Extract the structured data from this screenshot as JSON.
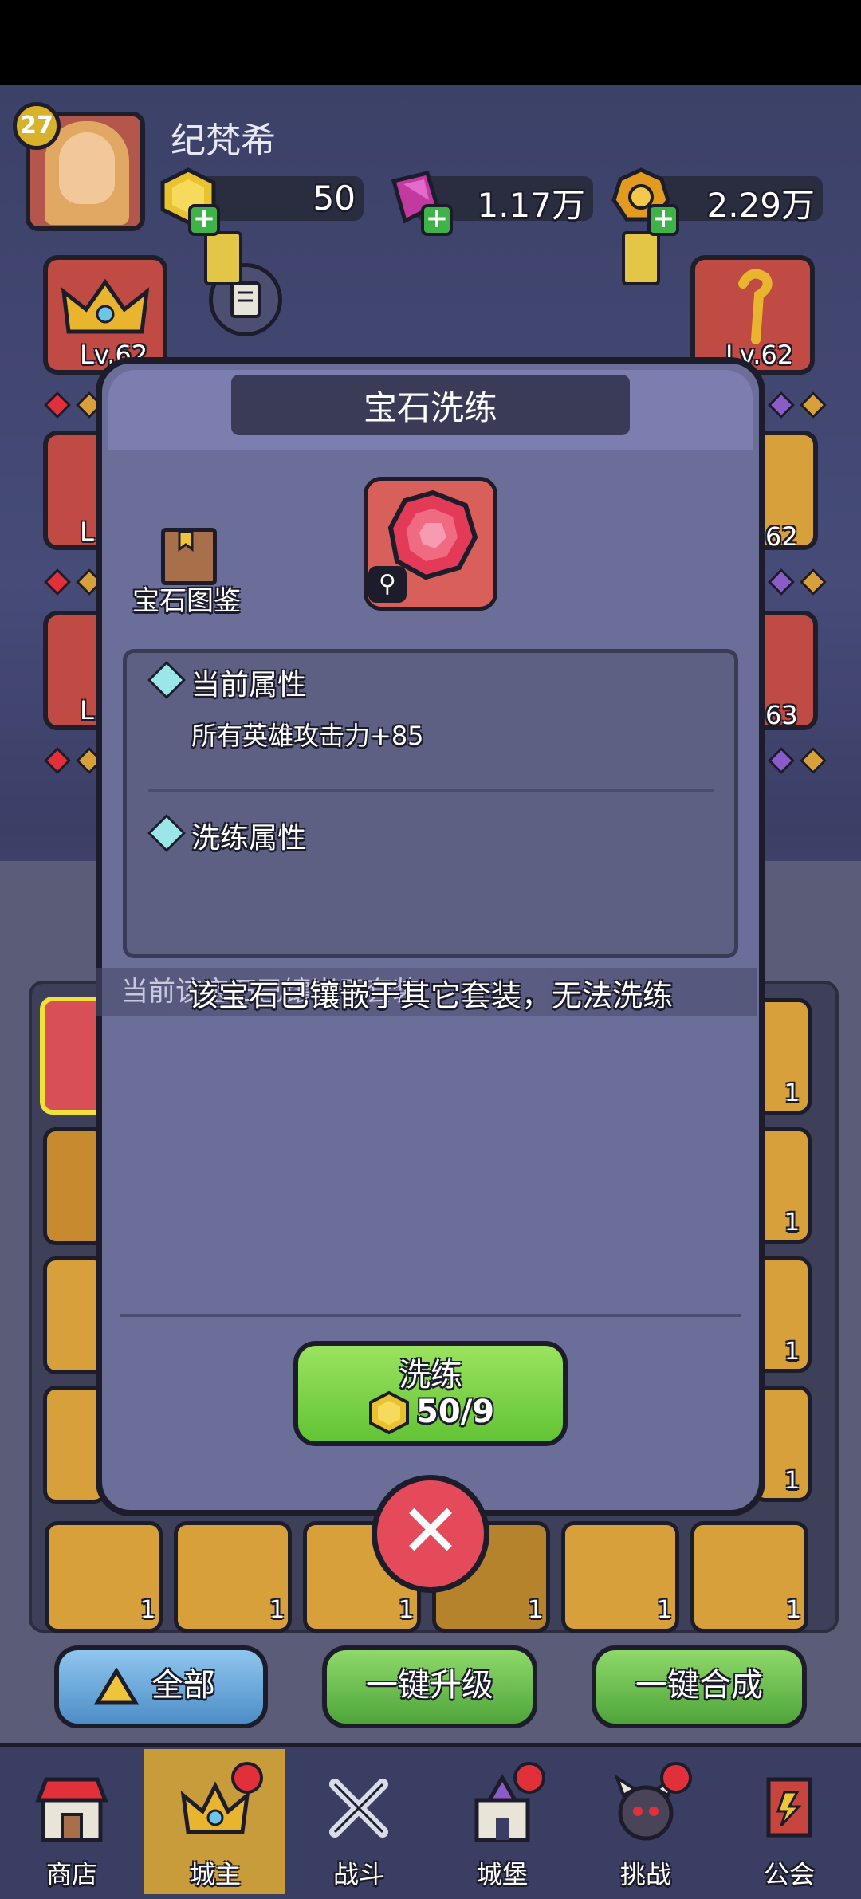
{
  "player": {
    "level": "27",
    "name": "纪梵希"
  },
  "resources": [
    {
      "icon": "gold-gem-icon",
      "value": "50"
    },
    {
      "icon": "purple-crystal-icon",
      "value": "1.17万"
    },
    {
      "icon": "gold-coin-icon",
      "value": "2.29万"
    }
  ],
  "side_slots": {
    "left_top_level": "Lv.62",
    "right_top_level": "Lv.62",
    "right_mid_level": "62",
    "right_low_level": "63",
    "left_mid_level": "L",
    "left_low_level": "L"
  },
  "modal": {
    "title": "宝石洗练",
    "gem_icon": "red-gem-icon",
    "gem_tag": "⚲",
    "book_label": "宝石图鉴",
    "current_attr_title": "当前属性",
    "current_attr_value": "所有英雄攻击力+85",
    "refine_attr_title": "洗练属性",
    "behind_text": "当前该宝石已镶嵌于套装",
    "toast": "该宝石已镶嵌于其它套装，无法洗练",
    "refine_button_label": "洗练",
    "refine_cost": "50/9"
  },
  "gem_row_counts": [
    "1",
    "1",
    "1",
    "1",
    "1",
    "1"
  ],
  "right_column_counts": [
    "1",
    "1",
    "1",
    "1"
  ],
  "actions": {
    "all": "全部",
    "upgrade": "一键升级",
    "combine": "一键合成"
  },
  "nav": [
    {
      "label": "商店",
      "icon": "shop-icon"
    },
    {
      "label": "城主",
      "icon": "lord-crown-icon"
    },
    {
      "label": "战斗",
      "icon": "crossed-swords-icon"
    },
    {
      "label": "城堡",
      "icon": "castle-icon"
    },
    {
      "label": "挑战",
      "icon": "demon-head-icon"
    },
    {
      "label": "公会",
      "icon": "guild-banner-icon"
    }
  ],
  "colors": {
    "accent_green": "#62c335",
    "modal_bg": "#6c6e9a",
    "alert_red": "#e2303b"
  }
}
